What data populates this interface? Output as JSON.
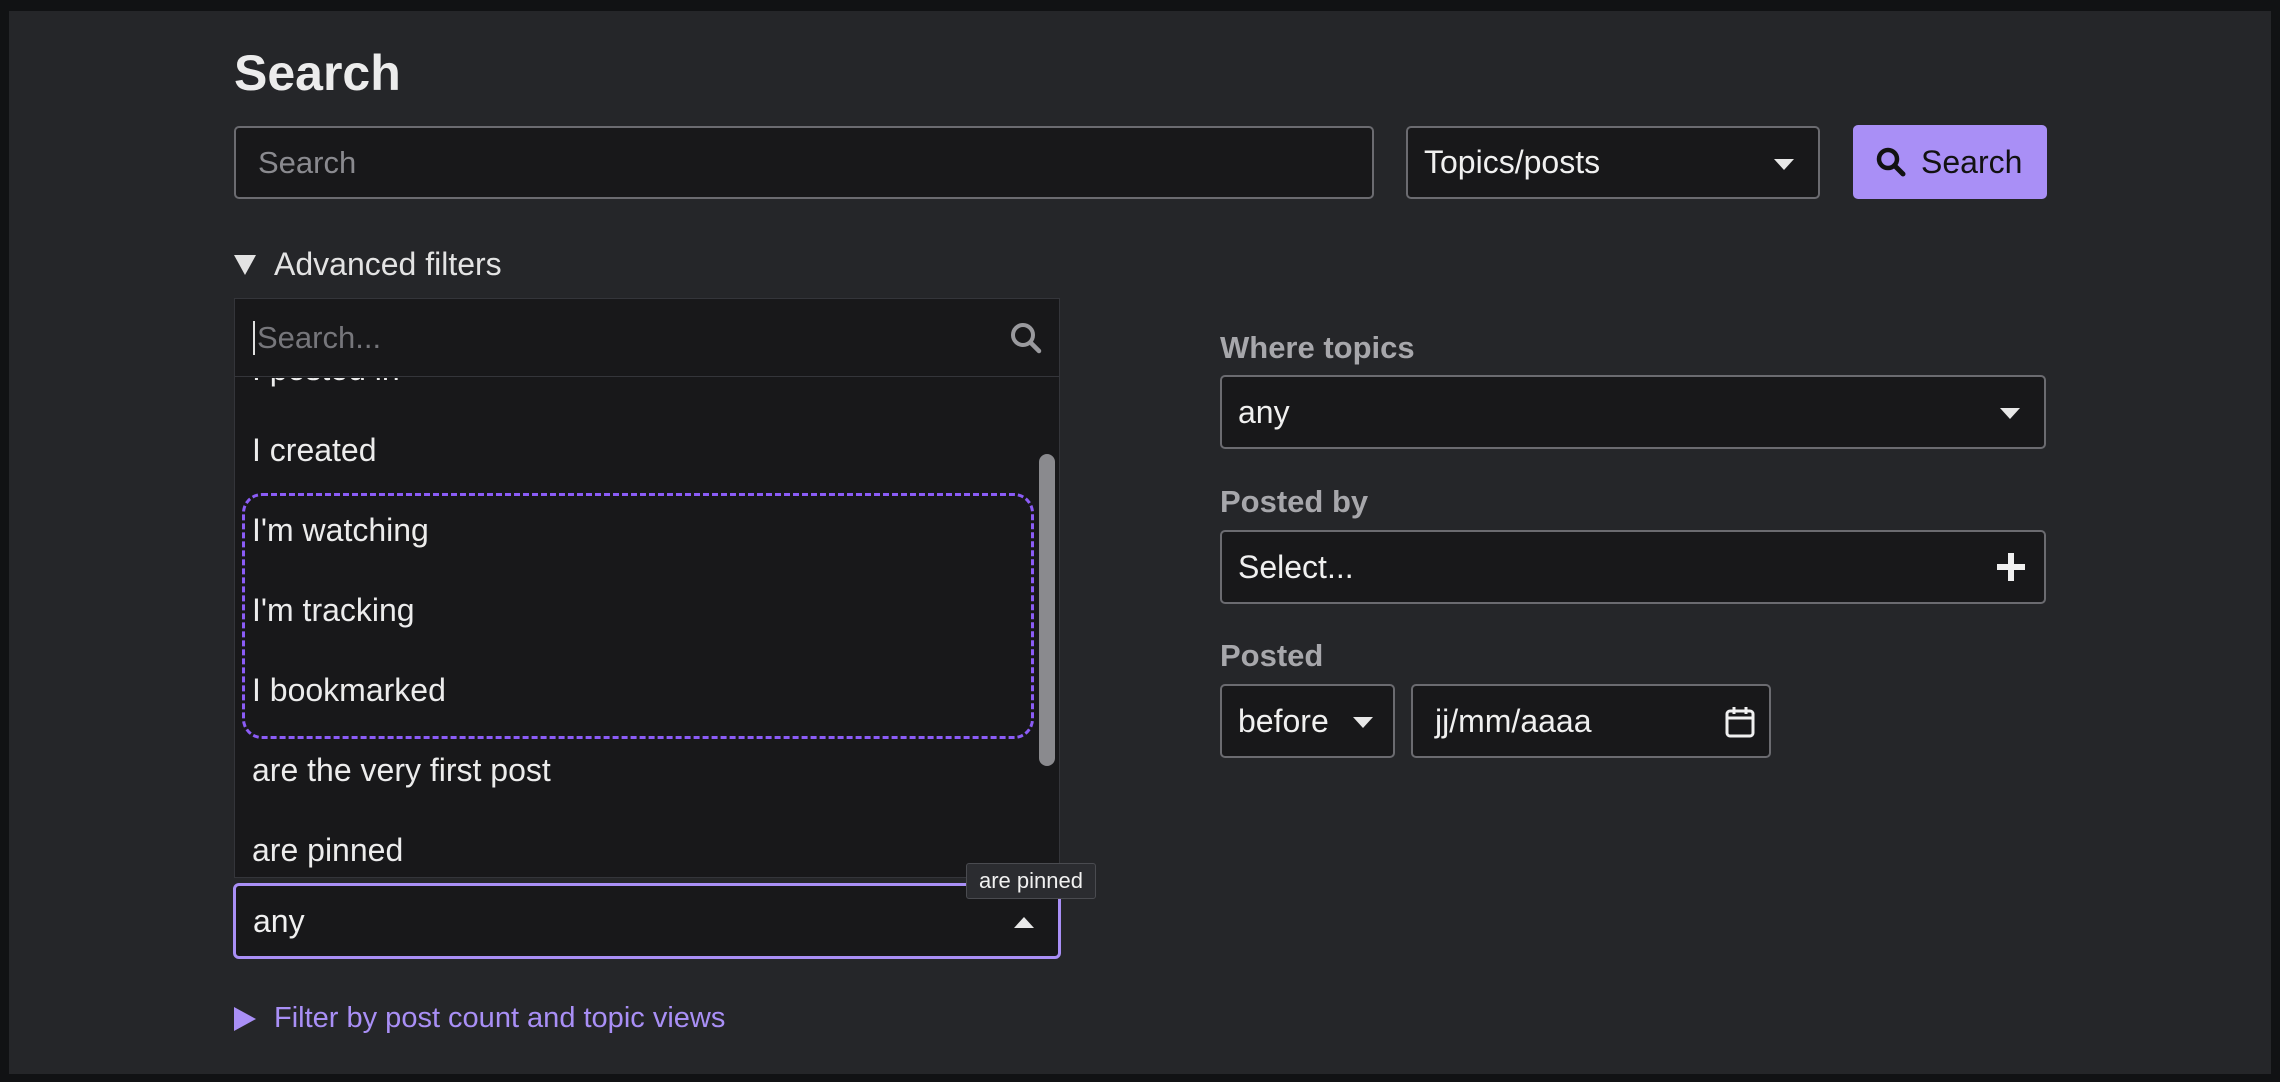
{
  "page": {
    "title": "Search"
  },
  "search": {
    "placeholder": "Search",
    "scope_value": "Topics/posts",
    "button_label": "Search"
  },
  "advanced": {
    "toggle_label": "Advanced filters",
    "dropdown": {
      "search_placeholder": "Search...",
      "items": [
        "I posted in",
        "I created",
        "I'm watching",
        "I'm tracking",
        "I bookmarked",
        "are the very first post",
        "are pinned"
      ]
    },
    "selected_value": "any",
    "tooltip": "are pinned",
    "post_count_link": "Filter by post count and topic views"
  },
  "filters": {
    "where_topics_label": "Where topics",
    "where_topics_value": "any",
    "posted_by_label": "Posted by",
    "posted_by_placeholder": "Select...",
    "posted_label": "Posted",
    "posted_when": "before",
    "date_placeholder": "jj/mm/aaaa"
  },
  "colors": {
    "accent": "#a98ff6",
    "highlight_dash": "#8b5cf6",
    "background": "#252629"
  },
  "icons": {
    "search": "search-icon",
    "plus": "plus-icon",
    "calendar": "calendar-icon"
  }
}
